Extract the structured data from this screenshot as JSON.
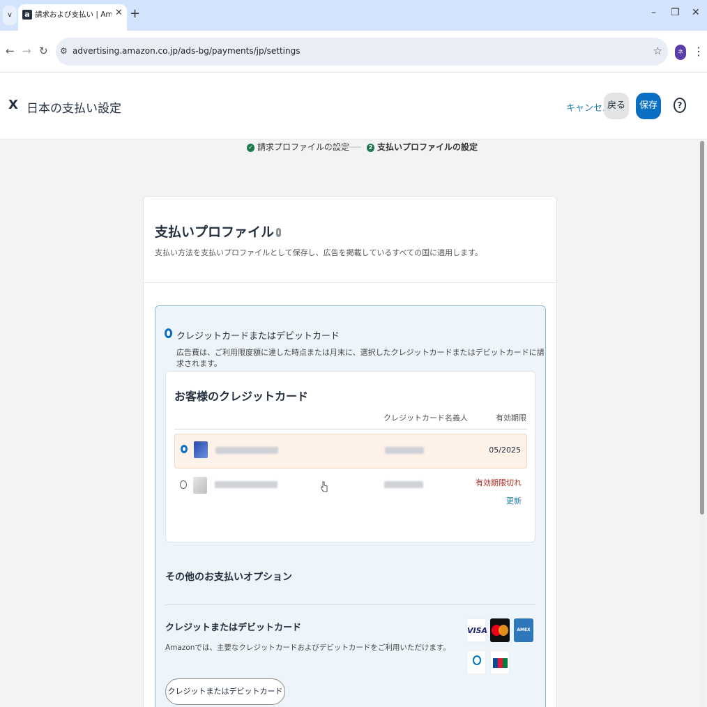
{
  "browser": {
    "tab_title": "請求および支払い | Amazon Ads",
    "url": "advertising.amazon.co.jp/ads-bg/payments/jp/settings",
    "profile_initial": "ネ"
  },
  "header": {
    "title": "日本の支払い設定",
    "cancel": "キャンセル",
    "back": "戻る",
    "save": "保存",
    "help": "?"
  },
  "stepper": {
    "step1": "請求プロファイルの設定",
    "step2_num": "2",
    "step2": "支払いプロファイルの設定"
  },
  "payment_profile": {
    "title": "支払いプロファイル",
    "subtitle": "支払い方法を支払いプロファイルとして保存し、広告を掲載しているすべての国に適用します。",
    "option_title": "クレジットカードまたはデビットカード",
    "option_desc": "広告費は、ご利用限度額に達した時点または月末に、選択したクレジットカードまたはデビットカードに請求されます。",
    "cards_title": "お客様のクレジットカード",
    "col_holder": "クレジットカード名義人",
    "col_expiry": "有効期限",
    "cards": [
      {
        "expiry": "05/2025",
        "selected": true
      },
      {
        "expiry": "有効期限切れ",
        "action": "更新",
        "selected": false
      }
    ]
  },
  "other_options": {
    "title": "その他のお支払いオプション",
    "cc_title": "クレジットまたはデビットカード",
    "cc_desc": "Amazonでは、主要なクレジットカードおよびデビットカードをご利用いただけます。",
    "add_button": "クレジットまたはデビットカードを追加",
    "logos": [
      "VISA",
      "MasterCard",
      "AMEX",
      "Diners Club",
      "JCB"
    ]
  },
  "colors": {
    "accent": "#0a6fc2",
    "link": "#1f7ea8",
    "success": "#1e7a4d",
    "error": "#b1281c"
  }
}
